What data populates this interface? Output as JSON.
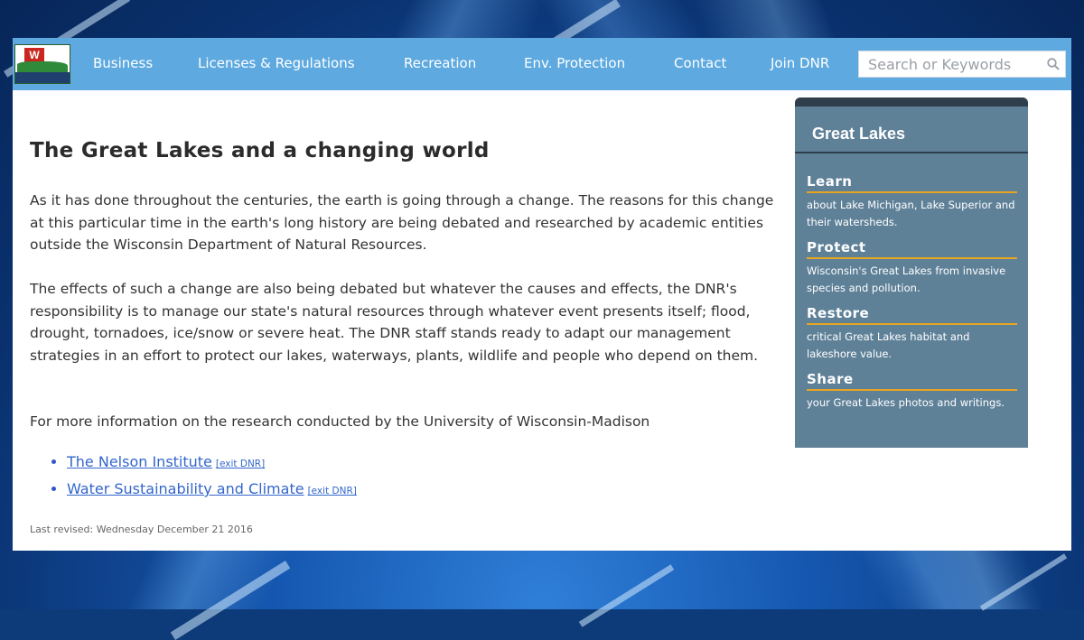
{
  "nav": {
    "items": [
      "Business",
      "Licenses & Regulations",
      "Recreation",
      "Env. Protection",
      "Contact",
      "Join DNR"
    ],
    "search_placeholder": "Search or Keywords"
  },
  "main": {
    "title": "The Great Lakes and a changing world",
    "paragraphs": [
      "As it has done throughout the centuries, the earth is going through a change. The reasons for this change at this particular time in the earth's long history are being debated and researched by academic entities outside the Wisconsin Department of Natural Resources.",
      "The effects of such a change are also being debated but whatever the causes and effects, the DNR's responsibility is to manage our state's natural resources through whatever event presents itself; flood, drought, tornadoes, ice/snow or severe heat. The DNR staff stands ready to adapt our management strategies in an effort to protect our lakes, waterways, plants, wildlife and people who depend on them.",
      "For more information on the research conducted by the University of Wisconsin-Madison"
    ],
    "links": [
      {
        "label": "The Nelson Institute",
        "exit": "[exit DNR]"
      },
      {
        "label": "Water Sustainability and Climate",
        "exit": "[exit DNR]"
      }
    ],
    "revised": "Last revised: Wednesday December 21 2016"
  },
  "sidebar": {
    "title": "Great Lakes",
    "sections": [
      {
        "title": "Learn",
        "text": "about Lake Michigan, Lake Superior and their watersheds."
      },
      {
        "title": "Protect",
        "text": "Wisconsin's Great Lakes from invasive species and pollution."
      },
      {
        "title": "Restore",
        "text": "critical Great Lakes habitat and lakeshore value."
      },
      {
        "title": "Share",
        "text": "your Great Lakes photos and writings."
      }
    ]
  },
  "colors": {
    "nav_bg": "#5da9e0",
    "sidebar_bg": "#5f8198",
    "sidebar_accent": "#e8a520",
    "link": "#3366cc"
  }
}
